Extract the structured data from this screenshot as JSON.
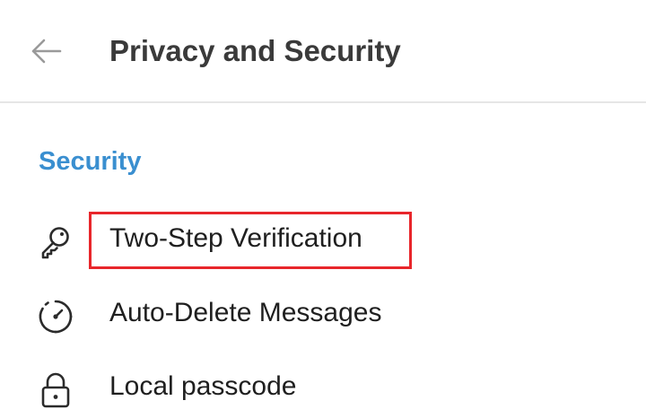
{
  "header": {
    "title": "Privacy and Security",
    "back_icon": "arrow-left-icon"
  },
  "section": {
    "title": "Security",
    "accent_color": "#3a8fd0"
  },
  "items": [
    {
      "label": "Two-Step Verification",
      "icon": "key-icon",
      "highlighted": true
    },
    {
      "label": "Auto-Delete Messages",
      "icon": "timer-icon"
    },
    {
      "label": "Local passcode",
      "icon": "lock-icon"
    }
  ],
  "highlight_color": "#e8262b"
}
